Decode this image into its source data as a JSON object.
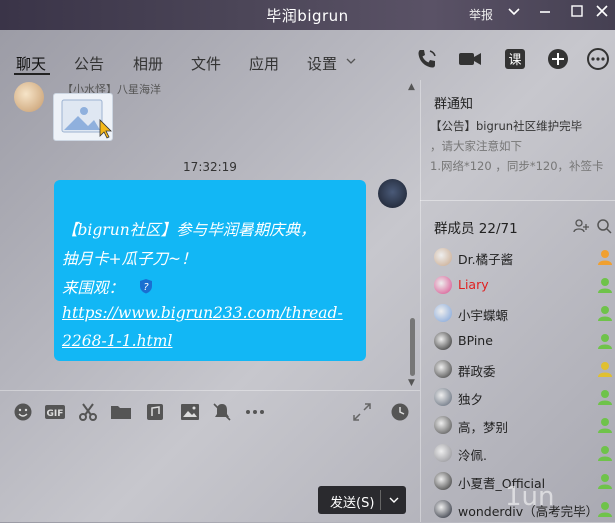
{
  "window": {
    "title": "毕润bigrun",
    "report_label": "举报",
    "icons": [
      "chevron-down-icon",
      "minimize-icon",
      "maximize-icon",
      "close-icon"
    ]
  },
  "tabs": [
    {
      "label": "聊天",
      "active": true
    },
    {
      "label": "公告"
    },
    {
      "label": "相册"
    },
    {
      "label": "文件"
    },
    {
      "label": "应用"
    },
    {
      "label": "设置"
    }
  ],
  "toolbar_icons": [
    "phone-icon",
    "video-icon",
    "course-icon",
    "add-icon",
    "more-icon"
  ],
  "chat": {
    "prev_sender": "【小水怪】八星海洋",
    "timestamp": "17:32:19",
    "message": {
      "line1": "【bigrun社区】参与毕润暑期庆典，",
      "line2": "抽月卡+瓜子刀~！",
      "line3": "来围观：",
      "link1": "https://www.bigrun233.com/thread-",
      "link2": "2268-1-1.html"
    }
  },
  "input_toolbar_icons": [
    "emoji-icon",
    "gif-icon",
    "scissors-icon",
    "folder-icon",
    "music-icon",
    "image-icon",
    "mute-icon",
    "more-dots-icon"
  ],
  "send": {
    "label": "发送(S)"
  },
  "notice": {
    "title": "群通知",
    "line1": "【公告】bigrun社区维护完毕",
    "line2": "，请大家注意如下",
    "line3": "1.网络*120 ，同步*120，补签卡"
  },
  "members": {
    "title": "群成员 22/71",
    "list": [
      {
        "name": "Dr.橘子酱",
        "color": "#c8a78a",
        "badge_color": "#f0a030"
      },
      {
        "name": "Liary",
        "color": "#d64a8a",
        "red": true,
        "badge_color": "#6fc34a"
      },
      {
        "name": "小宇蝶螈",
        "color": "#7aa0d8",
        "badge_color": "#6fc34a"
      },
      {
        "name": "BPine",
        "color": "#222222",
        "badge_color": "#6fc34a"
      },
      {
        "name": "群政委",
        "color": "#333333",
        "badge_color": "#e0c030"
      },
      {
        "name": "独夕",
        "color": "#556070",
        "badge_color": "#6fc34a"
      },
      {
        "name": "高，梦别",
        "color": "#444444",
        "badge_color": "#6fc34a"
      },
      {
        "name": "泠佩.",
        "color": "#8a8a90",
        "badge_color": "#6fc34a"
      },
      {
        "name": "小夏耆_Official",
        "color": "#2a2a2a",
        "badge_color": "#6fc34a"
      },
      {
        "name": "wonderdiv（高考完毕）",
        "color": "#1a1f2c",
        "badge_color": "#6fc34a"
      }
    ]
  },
  "watermark": "1un",
  "colors": {
    "bubble": "#12b7f5",
    "titlebar": "#3a3448",
    "send_button": "#2a2a2e"
  }
}
